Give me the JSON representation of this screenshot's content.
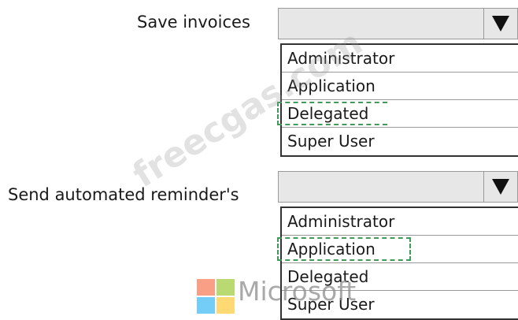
{
  "questions": [
    {
      "label": "Save invoices",
      "selected_value": "",
      "options": [
        "Administrator",
        "Application",
        "Delegated",
        "Super User"
      ],
      "highlighted_option": "Delegated"
    },
    {
      "label": "Send automated reminder's",
      "selected_value": "",
      "options": [
        "Administrator",
        "Application",
        "Delegated",
        "Super User"
      ],
      "highlighted_option": "Application"
    }
  ],
  "watermark": {
    "text": "freecgas.com"
  },
  "brand": {
    "name": "Microsoft",
    "logo_colors": [
      "#f25022",
      "#7fba00",
      "#00a4ef",
      "#ffb900"
    ]
  },
  "colors": {
    "highlight_border": "#3f9a5c",
    "dropdown_bg": "#e7e7e7"
  },
  "icons": {
    "dropdown_arrow": "triangle-down-icon"
  }
}
